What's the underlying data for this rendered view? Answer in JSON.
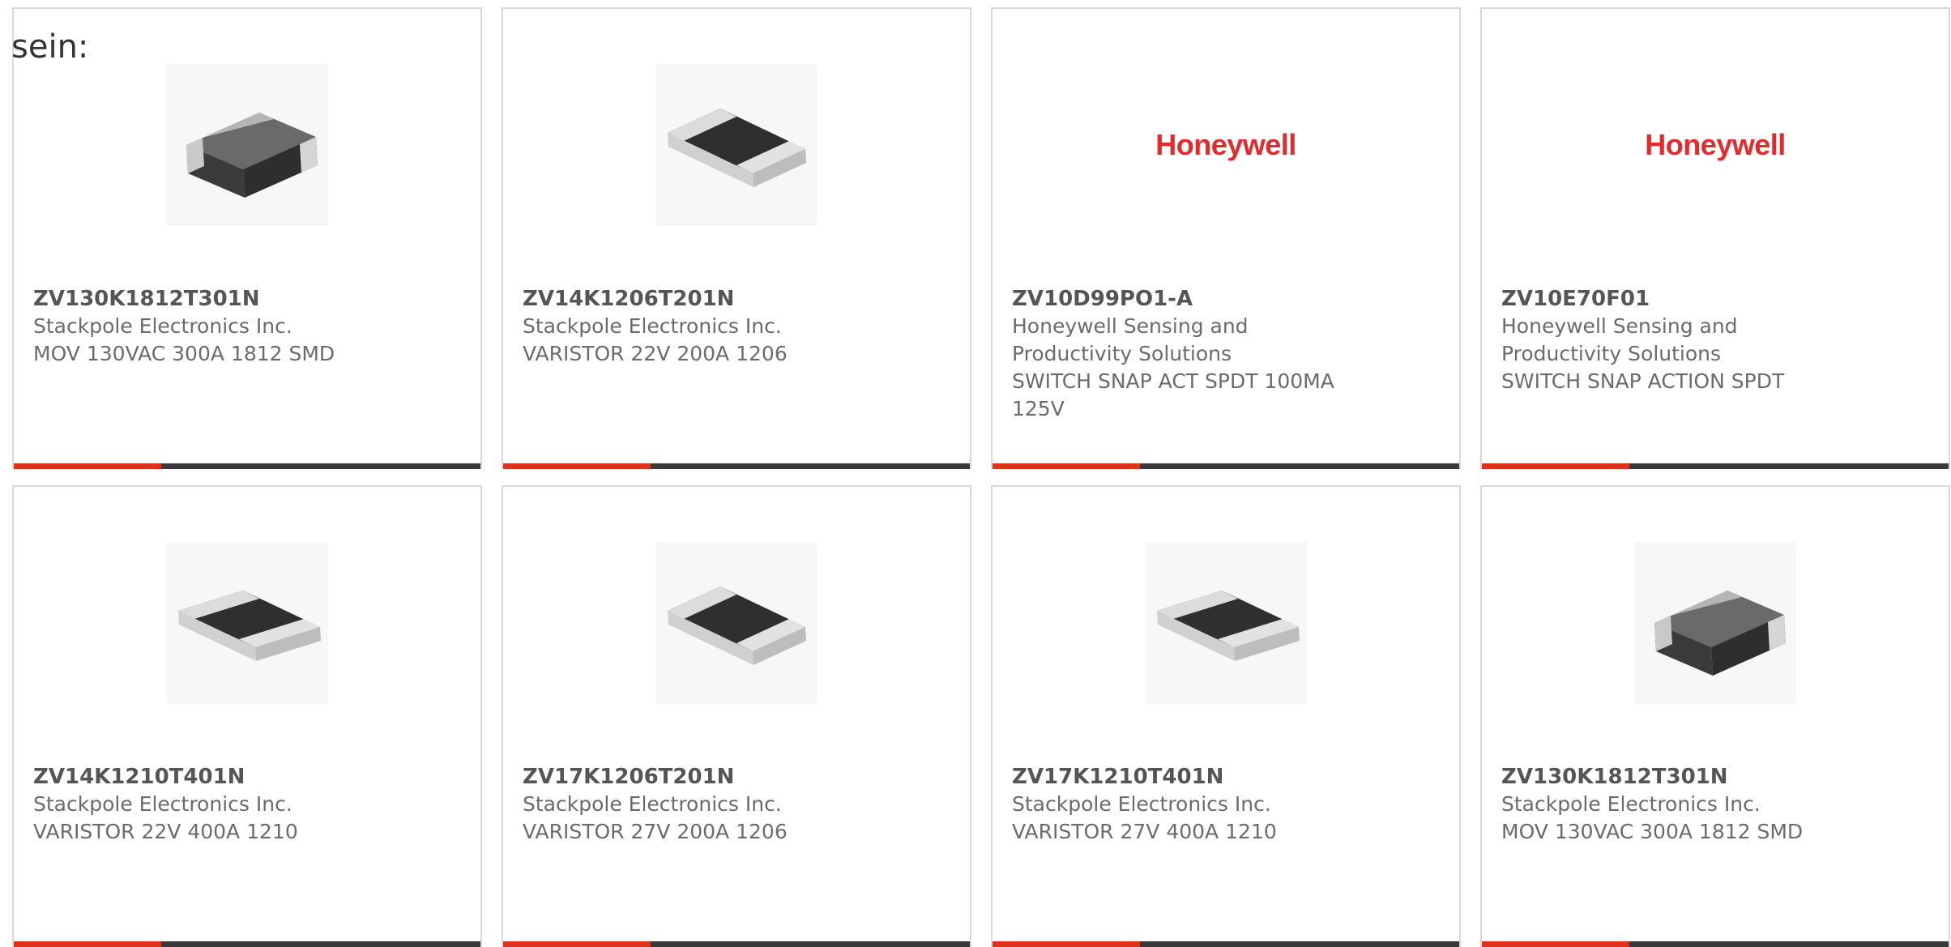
{
  "intro": "sein:",
  "colors": {
    "accent": "#e0311a",
    "bar": "#3a3a3a",
    "logo": "#e32b2b"
  },
  "products": [
    {
      "part": "ZV130K1812T301N",
      "manufacturer": "Stackpole Electronics Inc.",
      "description": "MOV 130VAC 300A 1812 SMD",
      "image": "chip-tall"
    },
    {
      "part": "ZV14K1206T201N",
      "manufacturer": "Stackpole Electronics Inc.",
      "description": "VARISTOR 22V 200A 1206",
      "image": "chip-flat"
    },
    {
      "part": "ZV10D99PO1-A",
      "manufacturer": "Honeywell Sensing and Productivity Solutions",
      "description": "SWITCH SNAP ACT SPDT 100MA 125V",
      "image": "logo",
      "logo_text": "Honeywell"
    },
    {
      "part": "ZV10E70F01",
      "manufacturer": "Honeywell Sensing and Productivity Solutions",
      "description": "SWITCH SNAP ACTION SPDT",
      "image": "logo",
      "logo_text": "Honeywell"
    },
    {
      "part": "ZV14K1210T401N",
      "manufacturer": "Stackpole Electronics Inc.",
      "description": "VARISTOR 22V 400A 1210",
      "image": "chip-flat"
    },
    {
      "part": "ZV17K1206T201N",
      "manufacturer": "Stackpole Electronics Inc.",
      "description": "VARISTOR 27V 200A 1206",
      "image": "chip-flat"
    },
    {
      "part": "ZV17K1210T401N",
      "manufacturer": "Stackpole Electronics Inc.",
      "description": "VARISTOR 27V 400A 1210",
      "image": "chip-flat"
    },
    {
      "part": "ZV130K1812T301N",
      "manufacturer": "Stackpole Electronics Inc.",
      "description": "MOV 130VAC 300A 1812 SMD",
      "image": "chip-tall"
    }
  ]
}
